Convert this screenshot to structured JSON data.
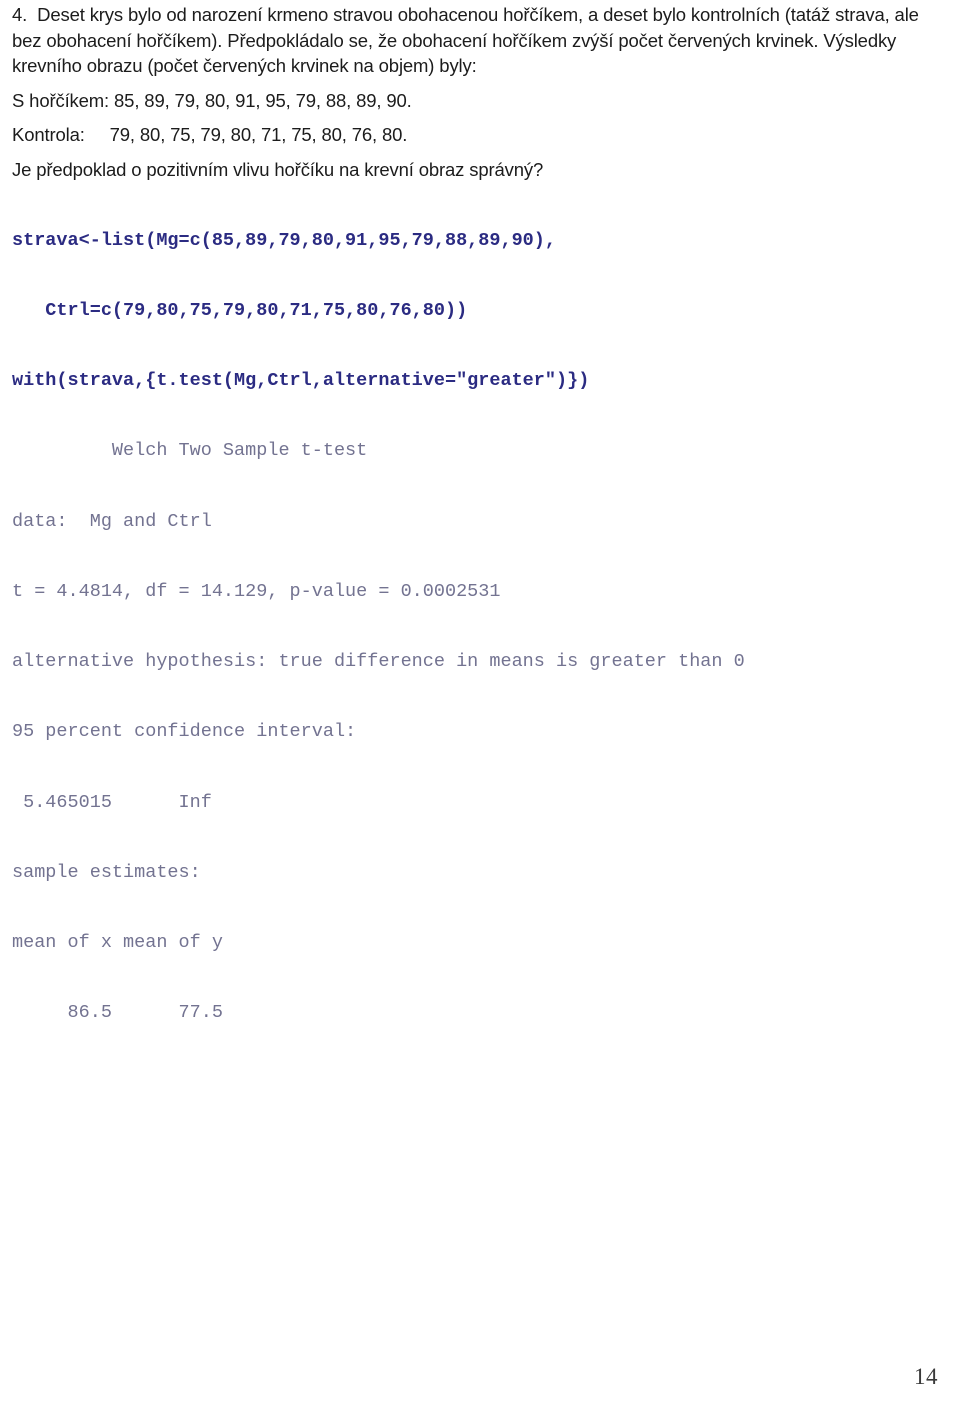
{
  "document": {
    "page_number": "14",
    "colors": {
      "body_text": "#1c1c1c",
      "source_code": "#2b2b82",
      "console_output": "#737391",
      "background": "#ffffff"
    }
  },
  "task": {
    "number": "4.",
    "paragraph": "Deset krys bylo od narození krmeno stravou obohacenou hořčíkem, a deset bylo kontrolních (tatáž strava, ale bez obohacení hořčíkem). Předpokládalo se, že obohacení hořčíkem zvýší počet červených krvinek. Výsledky krevního obrazu (počet červených krvinek na objem) byly:",
    "group_mg_label": "S hořčíkem:",
    "group_mg_values": "85, 89, 79, 80, 91, 95, 79, 88, 89, 90.",
    "group_ctrl_label": "Kontrola:",
    "group_ctrl_values": "79, 80, 75, 79, 80, 71, 75, 80, 76, 80.",
    "question": "Je předpoklad o pozitivním vlivu hořčíku na krevní obraz správný?"
  },
  "console": {
    "source_lines": [
      "strava<-list(Mg=c(85,89,79,80,91,95,79,88,89,90),",
      "   Ctrl=c(79,80,75,79,80,71,75,80,76,80))",
      "with(strava,{t.test(Mg,Ctrl,alternative=\"greater\")})"
    ],
    "output_lines": [
      "         Welch Two Sample t-test",
      "data:  Mg and Ctrl",
      "t = 4.4814, df = 14.129, p-value = 0.0002531",
      "alternative hypothesis: true difference in means is greater than 0",
      "95 percent confidence interval:",
      " 5.465015      Inf",
      "sample estimates:",
      "mean of x mean of y",
      "     86.5      77.5"
    ]
  },
  "statistics": {
    "t": "4.4814",
    "df": "14.129",
    "p_value": "0.0002531",
    "confidence_level": "95 percent",
    "ci_lower": "5.465015",
    "ci_upper": "Inf",
    "mean_of_x": "86.5",
    "mean_of_y": "77.5",
    "test_name": "Welch Two Sample t-test",
    "alternative": "true difference in means is greater than 0"
  }
}
